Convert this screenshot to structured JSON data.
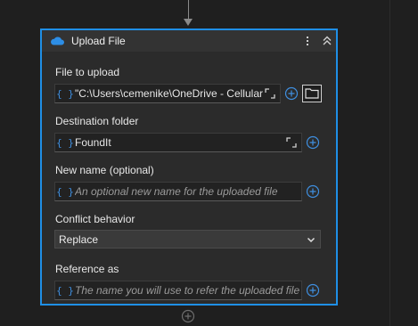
{
  "action": {
    "title": "Upload File"
  },
  "fields": {
    "file_to_upload": {
      "label": "File to upload",
      "value": "\"C:\\Users\\cemenike\\OneDrive - Cellular"
    },
    "destination_folder": {
      "label": "Destination folder",
      "value": "FoundIt"
    },
    "new_name": {
      "label": "New name (optional)",
      "placeholder": "An optional new name for the uploaded file"
    },
    "conflict_behavior": {
      "label": "Conflict behavior",
      "selected": "Replace"
    },
    "reference_as": {
      "label": "Reference as",
      "placeholder": "The name you will use to refer the uploaded file"
    }
  },
  "icons": {
    "variable": "{ }",
    "accent_color": "#1f8fe6",
    "variable_color": "#3f8fe0"
  }
}
